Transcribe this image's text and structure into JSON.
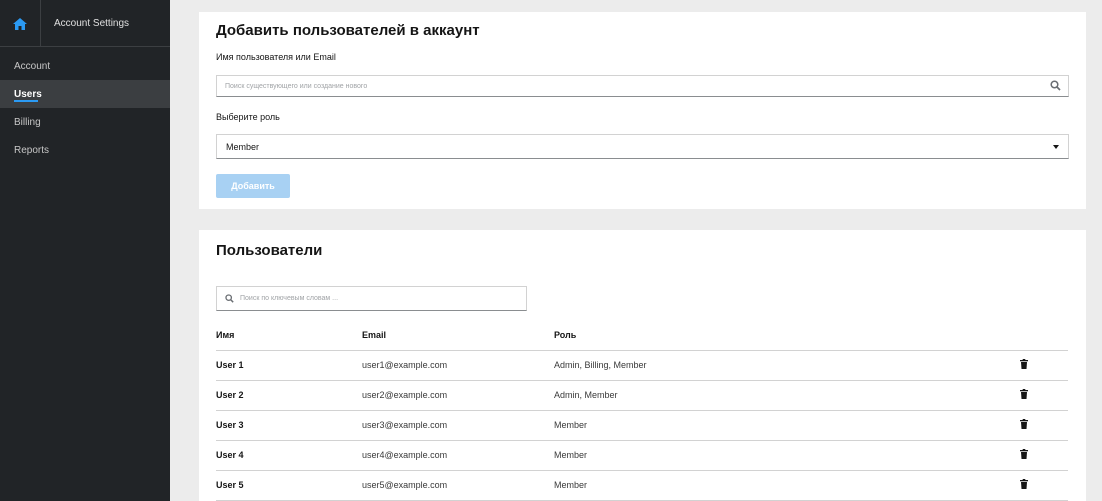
{
  "sidebar": {
    "title": "Account Settings",
    "items": [
      {
        "label": "Account"
      },
      {
        "label": "Users"
      },
      {
        "label": "Billing"
      },
      {
        "label": "Reports"
      }
    ]
  },
  "add_card": {
    "title": "Добавить пользователей в аккаунт",
    "user_label": "Имя пользователя или Email",
    "user_placeholder": "Поиск существующего или создание нового",
    "role_label": "Выберите роль",
    "role_selected": "Member",
    "add_button": "Добавить"
  },
  "users_card": {
    "title": "Пользователи",
    "filter_placeholder": "Поиск по ключевым словам ...",
    "columns": {
      "name": "Имя",
      "email": "Email",
      "role": "Роль"
    },
    "rows": [
      {
        "name": "User 1",
        "email": "user1@example.com",
        "role": "Admin, Billing, Member"
      },
      {
        "name": "User 2",
        "email": "user2@example.com",
        "role": "Admin, Member"
      },
      {
        "name": "User 3",
        "email": "user3@example.com",
        "role": "Member"
      },
      {
        "name": "User 4",
        "email": "user4@example.com",
        "role": "Member"
      },
      {
        "name": "User 5",
        "email": "user5@example.com",
        "role": "Member"
      }
    ]
  },
  "icons": {
    "home": "home-icon",
    "search": "search-icon",
    "caret": "caret-down-icon",
    "delete": "trash-icon"
  },
  "colors": {
    "accent": "#2b9af3",
    "sidebar_bg": "#212427",
    "button_disabled": "#a8d1f3"
  }
}
